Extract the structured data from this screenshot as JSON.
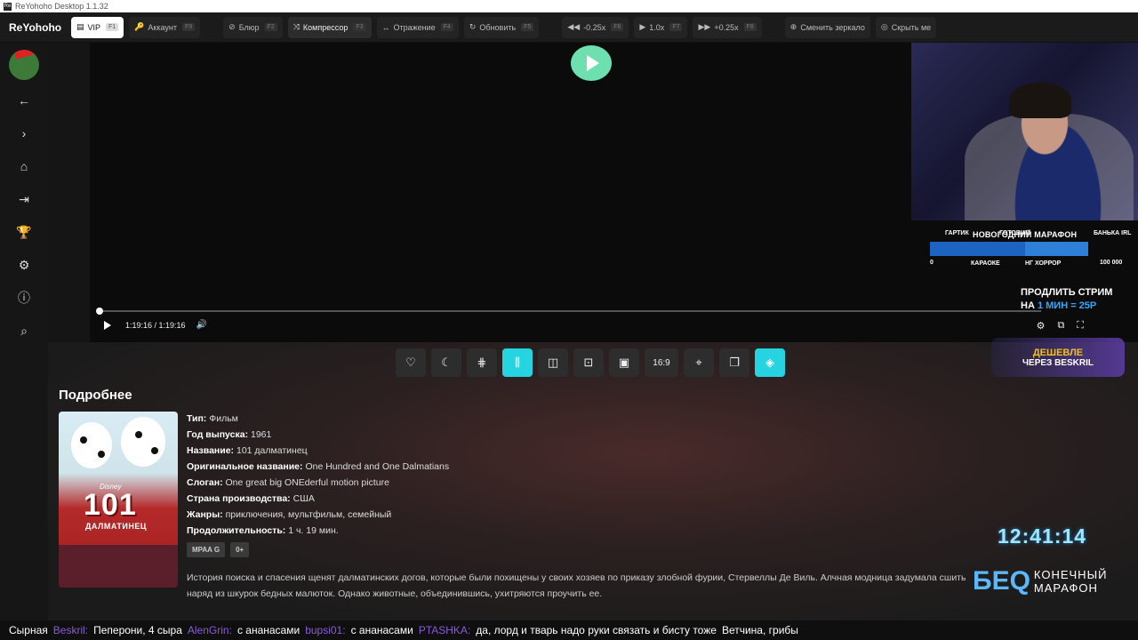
{
  "window": {
    "title": "ReYohoho Desktop 1.1.32",
    "app_icon": "Re"
  },
  "toolbar": {
    "brand": "ReYohoho",
    "buttons": [
      {
        "icon": "▤",
        "label": "VIP",
        "key": "F1",
        "active": true
      },
      {
        "icon": "🔑",
        "label": "Аккаунт",
        "key": "F9"
      },
      {
        "icon": "⊘",
        "label": "Блюр",
        "key": "F2"
      },
      {
        "icon": "⤨",
        "label": "Компрессор",
        "key": "F3",
        "dark": true
      },
      {
        "icon": "↔",
        "label": "Отражение",
        "key": "F4"
      },
      {
        "icon": "↻",
        "label": "Обновить",
        "key": "F5"
      },
      {
        "icon": "◀◀",
        "label": "-0.25x",
        "key": "F6"
      },
      {
        "icon": "▶",
        "label": "1.0x",
        "key": "F7"
      },
      {
        "icon": "▶▶",
        "label": "+0.25x",
        "key": "F8"
      },
      {
        "icon": "⊕",
        "label": "Сменить зеркало",
        "key": ""
      },
      {
        "icon": "◎",
        "label": "Скрыть ме",
        "key": ""
      }
    ]
  },
  "player": {
    "time": "1:19:16 / 1:19:16",
    "progress": 0
  },
  "marathon": {
    "title": "НОВОГОДНИЙ МАРАФОН",
    "top_labels": [
      "ГАРТИК",
      "ГОТОВИМ",
      "БАНЬКА IRL"
    ],
    "bottom_labels": [
      "КАРАОКЕ",
      "НГ ХОРРОР"
    ],
    "start": "0",
    "end": "100 000",
    "fill": 0.6
  },
  "prolong": {
    "line1": "ПРОДЛИТЬ СТРИМ",
    "line2_prefix": "НА ",
    "line2_highlight": "1 МИН = 25Р"
  },
  "beskril": {
    "line1": "ДЕШЕВЛЕ",
    "line2": "ЧЕРЕЗ BESKRIL"
  },
  "icon_bar": {
    "aspect": "16:9"
  },
  "details": {
    "section_title": "Подробнее",
    "poster": {
      "brand": "Disney",
      "number": "101",
      "subtitle": "ДАЛМАТИНЕЦ"
    },
    "rows": [
      {
        "label": "Тип:",
        "value": "Фильм"
      },
      {
        "label": "Год выпуска:",
        "value": "1961"
      },
      {
        "label": "Название:",
        "value": "101 далматинец"
      },
      {
        "label": "Оригинальное название:",
        "value": "One Hundred and One Dalmatians"
      },
      {
        "label": "Слоган:",
        "value": "One great big ONEderful motion picture"
      },
      {
        "label": "Страна производства:",
        "value": "США"
      },
      {
        "label": "Жанры:",
        "value": "приключения, мультфильм, семейный"
      },
      {
        "label": "Продолжительность:",
        "value": "1 ч. 19 мин."
      }
    ],
    "badges": [
      "MPAA G",
      "0+"
    ],
    "description": "История поиска и спасения щенят далматинских догов, которые были похищены у своих хозяев по приказу злобной фурии, Стервеллы Де Виль. Алчная модница задумала сшить наряд из шкурок бедных малюток. Однако животные, объединившись, ухитряются проучить ее."
  },
  "overlay": {
    "clock": "12:41:14",
    "logo_abbr": "БЕQ",
    "logo_line1": "КОНЕЧНЫЙ",
    "logo_line2": "МАРАФОН"
  },
  "ticker": {
    "items": [
      {
        "text": "Сырная"
      },
      {
        "nick": "Beskril:",
        "text": "Пеперони, 4 сыра"
      },
      {
        "nick": "AlenGrin:",
        "text": "с ананасами"
      },
      {
        "nick": "bupsi01:",
        "text": "с ананасами"
      },
      {
        "nick": "PTASHKA:",
        "text": "да, лорд и тварь надо руки связать и бисту тоже"
      },
      {
        "nick": "",
        "text": "Ветчина, грибы"
      }
    ]
  }
}
